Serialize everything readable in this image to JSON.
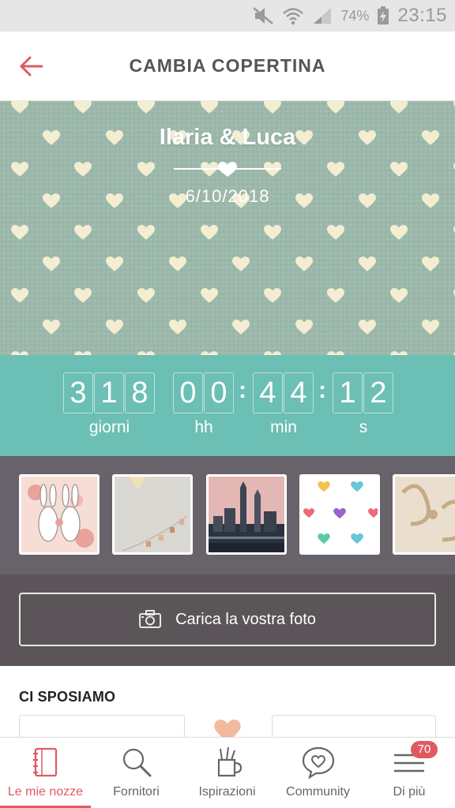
{
  "status_bar": {
    "battery_percent": "74%",
    "time": "23:15"
  },
  "header": {
    "title": "CAMBIA COPERTINA"
  },
  "cover": {
    "names": "Ilaria & Luca",
    "date": "6/10/2018"
  },
  "countdown": {
    "days_digits": [
      "3",
      "1",
      "8"
    ],
    "hours_digits": [
      "0",
      "0"
    ],
    "minutes_digits": [
      "4",
      "4"
    ],
    "seconds_digits": [
      "1",
      "2"
    ],
    "labels": {
      "days": "giorni",
      "hours": "hh",
      "minutes": "min",
      "seconds": "s"
    }
  },
  "upload": {
    "label": "Carica la vostra foto"
  },
  "section": {
    "title": "CI SPOSIAMO"
  },
  "nav": {
    "items": [
      {
        "label": "Le mie nozze",
        "icon": "notebook-icon"
      },
      {
        "label": "Fornitori",
        "icon": "magnifier-icon"
      },
      {
        "label": "Ispirazioni",
        "icon": "pencil-cup-icon"
      },
      {
        "label": "Community",
        "icon": "chat-heart-icon"
      },
      {
        "label": "Di più",
        "icon": "menu-icon"
      }
    ],
    "badge_count": "70",
    "active_index": 0
  },
  "colors": {
    "accent": "#e05a62",
    "teal": "#6cbfb4",
    "cover_green": "#9cb8ab",
    "dark_panel": "#68626a"
  }
}
